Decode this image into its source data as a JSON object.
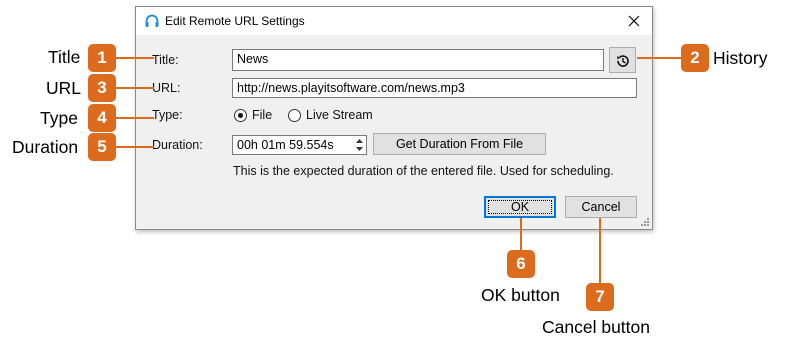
{
  "dialog": {
    "title": "Edit Remote URL Settings",
    "title_field": {
      "label": "Title:",
      "value": "News"
    },
    "url_field": {
      "label": "URL:",
      "value": "http://news.playitsoftware.com/news.mp3"
    },
    "type_field": {
      "label": "Type:",
      "options": [
        "File",
        "Live Stream"
      ],
      "selected": "File"
    },
    "duration_field": {
      "label": "Duration:",
      "value": "00h 01m 59.554s"
    },
    "get_duration_button": "Get Duration From File",
    "hint": "This is the expected duration of the entered file. Used for scheduling.",
    "ok_button": "OK",
    "cancel_button": "Cancel"
  },
  "annotations": [
    {
      "number": "1",
      "label": "Title"
    },
    {
      "number": "2",
      "label": "History"
    },
    {
      "number": "3",
      "label": "URL"
    },
    {
      "number": "4",
      "label": "Type"
    },
    {
      "number": "5",
      "label": "Duration"
    },
    {
      "number": "6",
      "label": "OK button"
    },
    {
      "number": "7",
      "label": "Cancel button"
    }
  ],
  "colors": {
    "badge": "#dd6b1e",
    "accent": "#0078d7"
  }
}
